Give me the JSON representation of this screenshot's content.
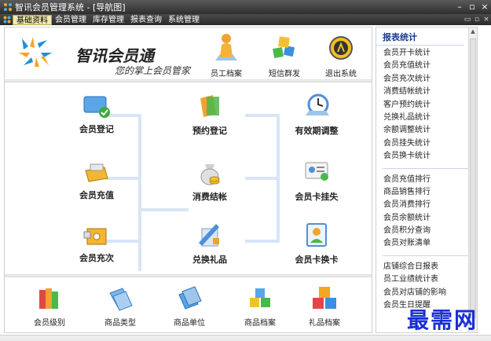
{
  "window": {
    "title": "智讯会员管理系统 - [导航图]",
    "controls": {
      "minimize": "–",
      "maximize": "▫",
      "close": "×"
    }
  },
  "menubar": {
    "items": [
      "基础资料",
      "会员管理",
      "库存管理",
      "报表查询",
      "系统管理"
    ],
    "active_index": 0,
    "mini_controls": [
      "▭",
      "▫",
      "×"
    ]
  },
  "header": {
    "brand_title": "智讯会员通",
    "brand_slogan": "您的掌上会员管家",
    "toolbar": [
      "员工档案",
      "短信群发",
      "退出系统"
    ]
  },
  "flow": {
    "left": [
      "会员登记",
      "会员充值",
      "会员充次"
    ],
    "middle": [
      "预约登记",
      "消费结帐",
      "兑换礼品"
    ],
    "right": [
      "有效期调整",
      "会员卡挂失",
      "会员卡换卡"
    ]
  },
  "bottom": {
    "items": [
      "会员级别",
      "商品类型",
      "商品单位",
      "商品档案",
      "礼品档案"
    ]
  },
  "side": {
    "title": "报表统计",
    "group1": [
      "会员开卡统计",
      "会员充值统计",
      "会员充次统计",
      "消费结帐统计",
      "客户预约统计",
      "兑换礼品统计",
      "余额调整统计",
      "会员挂失统计",
      "会员换卡统计"
    ],
    "group2": [
      "会员充值排行",
      "商品销售排行",
      "会员消费排行",
      "会员余额统计",
      "会员积分查询",
      "会员对账清单"
    ],
    "group3": [
      "店铺综合日报表",
      "员工业绩统计表",
      "会员对店铺的影响",
      "会员生日提醒"
    ]
  },
  "watermark": "最需网",
  "colors": {
    "titlebar": "#3a3a3a",
    "accent_blue": "#1a3a8a",
    "connector": "#d7e5f6",
    "watermark": "#1a2fd6"
  }
}
